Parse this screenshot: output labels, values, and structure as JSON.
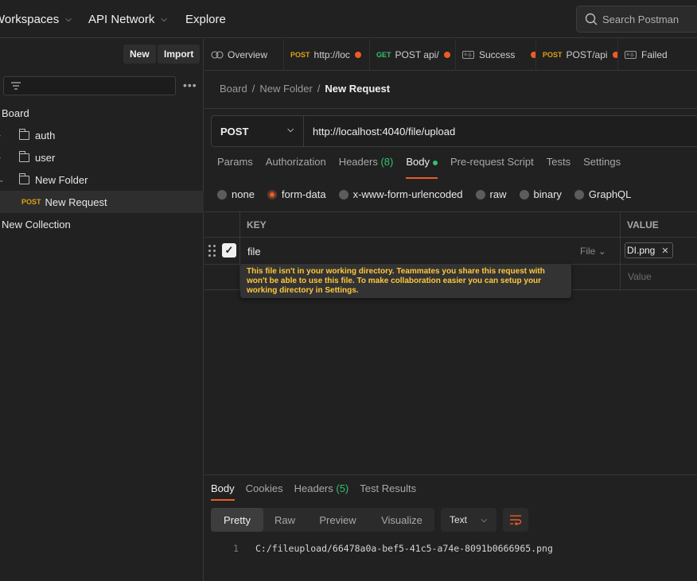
{
  "topbar": {
    "workspaces": "Workspaces",
    "api_network": "API Network",
    "explore": "Explore",
    "search_placeholder": "Search Postman"
  },
  "sidebar": {
    "new_label": "New",
    "import_label": "Import",
    "collection_name": "Board",
    "items": [
      {
        "label": "auth"
      },
      {
        "label": "user"
      },
      {
        "label": "New Folder"
      },
      {
        "method": "POST",
        "label": "New Request"
      }
    ],
    "new_collection": "New Collection"
  },
  "tabs": [
    {
      "label": "Overview"
    },
    {
      "method": "POST",
      "label": "http://loc"
    },
    {
      "method": "GET",
      "label": "POST api/"
    },
    {
      "label": "Success"
    },
    {
      "method": "POST",
      "label": "POST/api"
    },
    {
      "label": "Failed"
    }
  ],
  "breadcrumb": {
    "part1": "Board",
    "part2": "New Folder",
    "current": "New Request",
    "separator": "/"
  },
  "request": {
    "method": "POST",
    "url": "http://localhost:4040/file/upload"
  },
  "req_tabs": {
    "params": "Params",
    "authorization": "Authorization",
    "headers": "Headers",
    "headers_count": "(8)",
    "body": "Body",
    "pre_request": "Pre-request Script",
    "tests": "Tests",
    "settings": "Settings"
  },
  "body_types": {
    "none": "none",
    "form_data": "form-data",
    "urlencoded": "x-www-form-urlencoded",
    "raw": "raw",
    "binary": "binary",
    "graphql": "GraphQL"
  },
  "kv": {
    "key_header": "KEY",
    "value_header": "VALUE",
    "row_key": "file",
    "row_type": "File",
    "row_file": "DI.png",
    "value_placeholder": "Value"
  },
  "tooltip": {
    "line1": "This file isn't in your working directory. Teammates you share this request with",
    "line2": "won't be able to use this file. To make collaboration easier you can setup your",
    "line3": "working directory in Settings."
  },
  "response": {
    "body": "Body",
    "cookies": "Cookies",
    "headers": "Headers",
    "headers_count": "(5)",
    "test_results": "Test Results",
    "pretty": "Pretty",
    "raw": "Raw",
    "preview": "Preview",
    "visualize": "Visualize",
    "format": "Text",
    "line_no": "1",
    "code_line": "C:/fileupload/66478a0a-bef5-41c5-a74e-8091b0666965.png"
  },
  "colors": {
    "accent": "#ef5b25",
    "post": "#e0a010",
    "get": "#33c26b",
    "warning": "#ffc83d"
  }
}
